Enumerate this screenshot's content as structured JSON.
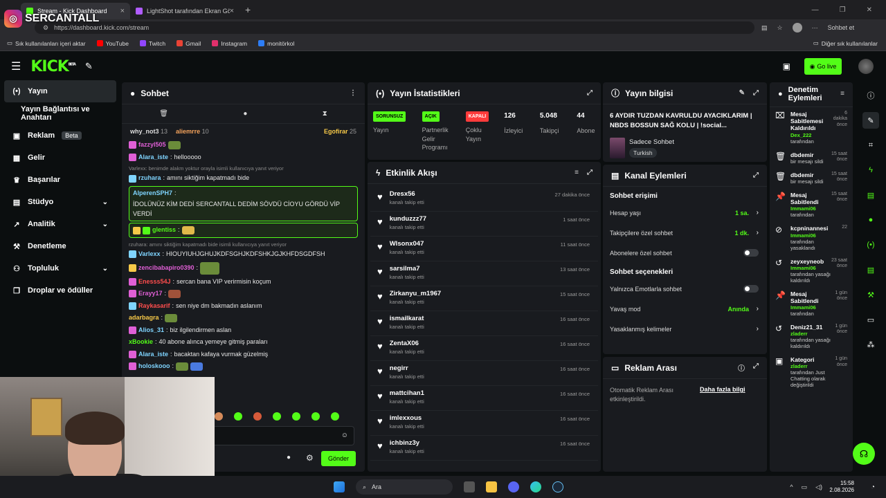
{
  "browser": {
    "tabs": [
      {
        "label": "Stream - Kick Dashboard",
        "active": true
      },
      {
        "label": "LightShot tarafından Ekran Görünt",
        "active": false
      }
    ],
    "url": "https://dashboard.kick.com/stream",
    "profile_label": "Sohbet et",
    "bookmarks": [
      "Sık kullanılanları içeri aktar",
      "YouTube",
      "Twitch",
      "Gmail",
      "Instagram",
      "monitörkol"
    ],
    "bookmarks_right": "Diğer sık kullanılanlar"
  },
  "overlay": {
    "streamer_name": "SERCANTALL"
  },
  "topbar": {
    "logo": "KICK",
    "logo_badge": "BETA",
    "go_live": "Go live"
  },
  "sidebar": {
    "items": [
      {
        "label": "Yayın",
        "icon": "broadcast-icon"
      },
      {
        "label": "Yayın Bağlantısı ve Anahtarı",
        "icon": ""
      },
      {
        "label": "Reklam",
        "icon": "ad-icon",
        "badge": "Beta"
      },
      {
        "label": "Gelir",
        "icon": "money-icon"
      },
      {
        "label": "Başarılar",
        "icon": "trophy-icon"
      },
      {
        "label": "Stüdyo",
        "icon": "studio-icon"
      },
      {
        "label": "Analitik",
        "icon": "analytics-icon"
      },
      {
        "label": "Denetleme",
        "icon": "hammer-icon"
      },
      {
        "label": "Topluluk",
        "icon": "community-icon"
      },
      {
        "label": "Droplar ve ödüller",
        "icon": "gift-icon"
      }
    ]
  },
  "chat": {
    "title": "Sohbet",
    "top_gifters": [
      {
        "name": "why_not3",
        "count": "13"
      },
      {
        "name": "aliemrre",
        "count": "10"
      },
      {
        "name": "Egofirar",
        "count": "25"
      }
    ],
    "messages": [
      {
        "user": "fazzyl505",
        "text": "",
        "color": "#e05fd6",
        "reply": ""
      },
      {
        "user": "Alara_iste",
        "text": "hellooooo",
        "color": "#7fd4ff",
        "reply": ""
      },
      {
        "user": "rzuhara",
        "text": "amını siktiğim kapatmadı bide",
        "color": "#7fd4ff",
        "reply": "Varlexx: benimde alakm yoktur orayla isimli kullanıcıya yanıt veriyor"
      },
      {
        "user": "AlperenSPH7",
        "text": "İDOLÜNÜZ KİM DEDİ SERCANTALL DEDİM SÖVDÜ CİOYU GÖRDÜ VİP VERDİ",
        "color": "#7fd4ff",
        "reply": ""
      },
      {
        "user": "glentiss",
        "text": "",
        "color": "#53fc18",
        "reply": ""
      },
      {
        "user": "Varlexx",
        "text": "HIOUYIUHJGHUJKDFSGHJKDFSHKJGJKHFDSGDFSH",
        "color": "#7fd4ff",
        "reply": "rzuhara: amını siktiğim kapatmadı bide isimli kullanıcıya yanıt veriyor"
      },
      {
        "user": "zencibabapiro0390",
        "text": "",
        "color": "#e05fd6",
        "reply": ""
      },
      {
        "user": "Enesss54J",
        "text": "sercan bana VIP verirmisin koçum",
        "color": "#ff4d4d",
        "reply": ""
      },
      {
        "user": "Erayy17",
        "text": "",
        "color": "#e05fd6",
        "reply": ""
      },
      {
        "user": "Raykasarif",
        "text": "sen niye dm bakmadın aslanım",
        "color": "#ff4d4d",
        "reply": ""
      },
      {
        "user": "adarbagra",
        "text": "",
        "color": "#f7c948",
        "reply": ""
      },
      {
        "user": "Alios_31",
        "text": "biz ilgilendirmen aslan",
        "color": "#7fd4ff",
        "reply": ""
      },
      {
        "user": "xBookie",
        "text": "40 abone alınca yemeye gitmiş paraları",
        "color": "#53fc18",
        "reply": ""
      },
      {
        "user": "Alara_iste",
        "text": "bacaktan kafaya vurmak güzelmiş",
        "color": "#7fd4ff",
        "reply": ""
      },
      {
        "user": "holoskooo",
        "text": "",
        "color": "#7fd4ff",
        "reply": ""
      }
    ],
    "send_label": "Gönder"
  },
  "stats": {
    "title": "Yayın İstatistikleri",
    "items": [
      {
        "tag": "SORUNSUZ",
        "label": "Yayın",
        "tag_color": "#53fc18"
      },
      {
        "tag": "AÇIK",
        "label": "Partnerlik Gelir Programı",
        "tag_color": "#53fc18"
      },
      {
        "tag": "KAPALI",
        "label": "Çoklu Yayın",
        "tag_color": "#ff3b3b"
      },
      {
        "num": "126",
        "label": "İzleyici"
      },
      {
        "num": "5.048",
        "label": "Takipçi"
      },
      {
        "num": "44",
        "label": "Abone Sayısı"
      }
    ]
  },
  "activity": {
    "title": "Etkinlik Akışı",
    "items": [
      {
        "name": "Dresx56",
        "sub": "kanalı takip etti",
        "time": "27 dakika önce"
      },
      {
        "name": "kunduzzz77",
        "sub": "kanalı takip etti",
        "time": "1 saat önce"
      },
      {
        "name": "Wlsonx047",
        "sub": "kanalı takip etti",
        "time": "11 saat önce"
      },
      {
        "name": "sarsilma7",
        "sub": "kanalı takip etti",
        "time": "13 saat önce"
      },
      {
        "name": "Zirkanyu_m1967",
        "sub": "kanalı takip etti",
        "time": "15 saat önce"
      },
      {
        "name": "ismailkarat",
        "sub": "kanalı takip etti",
        "time": "16 saat önce"
      },
      {
        "name": "ZentaX06",
        "sub": "kanalı takip etti",
        "time": "16 saat önce"
      },
      {
        "name": "negirr",
        "sub": "kanalı takip etti",
        "time": "16 saat önce"
      },
      {
        "name": "mattcihan1",
        "sub": "kanalı takip etti",
        "time": "16 saat önce"
      },
      {
        "name": "imlexxous",
        "sub": "kanalı takip etti",
        "time": "16 saat önce"
      },
      {
        "name": "ichbinz3y",
        "sub": "kanalı takip etti",
        "time": "16 saat önce"
      }
    ]
  },
  "stream_info": {
    "title": "Yayın bilgisi",
    "stream_title": "6 AYDIR TUZDAN KAVRULDU AYACIKLARIM | NBDS BOSSUN SAĞ KOLU | !social...",
    "category": "Sadece Sohbet",
    "language": "Turkish"
  },
  "channel_actions": {
    "title": "Kanal Eylemleri",
    "chat_access": "Sohbet erişimi",
    "rows1": [
      {
        "label": "Hesap yaşı",
        "value": "1 sa.",
        "type": "arrow"
      },
      {
        "label": "Takipçilere özel sohbet",
        "value": "1 dk.",
        "type": "arrow"
      },
      {
        "label": "Abonelere özel sohbet",
        "value": "",
        "type": "toggle"
      }
    ],
    "chat_options": "Sohbet seçenekleri",
    "rows2": [
      {
        "label": "Yalnızca Emotlarla sohbet",
        "value": "",
        "type": "toggle"
      },
      {
        "label": "Yavaş mod",
        "value": "Anında",
        "type": "arrow"
      },
      {
        "label": "Yasaklanmış kelimeler",
        "value": "",
        "type": "arrow"
      }
    ]
  },
  "ad_break": {
    "title": "Reklam Arası",
    "text": "Otomatik Reklam Arası etkinleştirildi.",
    "link": "Daha fazla bilgi"
  },
  "mod_actions": {
    "title": "Denetim Eylemleri",
    "items": [
      {
        "title": "Mesaj Sabitlemesi Kaldırıldı",
        "by": "Dex_222",
        "suffix": "tarafından",
        "time": "6 dakika önce",
        "icon": "unpin-icon"
      },
      {
        "title": "dbdemir",
        "by": "",
        "suffix": "bir mesajı sildi",
        "time": "15 saat önce",
        "icon": "trash-icon"
      },
      {
        "title": "dbdemir",
        "by": "",
        "suffix": "bir mesajı sildi",
        "time": "15 saat önce",
        "icon": "trash-icon"
      },
      {
        "title": "Mesaj Sabitlendi",
        "by": "Immami06",
        "suffix": "tarafından",
        "time": "15 saat önce",
        "icon": "pin-icon"
      },
      {
        "title": "kcpninannesi",
        "by": "Immami06",
        "suffix": "tarafından yasaklandı",
        "time": "22",
        "icon": "ban-icon"
      },
      {
        "title": "zeyxeyneob",
        "by": "Immami06",
        "suffix": "tarafından yasağı kaldırıldı",
        "time": "23 saat önce",
        "icon": "undo-icon"
      },
      {
        "title": "Mesaj Sabitlendi",
        "by": "Immami06",
        "suffix": "tarafından",
        "time": "1 gün önce",
        "icon": "pin-icon"
      },
      {
        "title": "Deniz21_31",
        "by": "zladerr",
        "suffix": "tarafından yasağı kaldırıldı",
        "time": "1 gün önce",
        "icon": "undo-icon"
      },
      {
        "title": "Kategori",
        "by": "zladerr",
        "suffix": "tarafından Just Chatting olarak değiştirildi",
        "time": "1 gün önce",
        "icon": "category-icon"
      }
    ]
  },
  "taskbar": {
    "search": "Ara",
    "time": "15:58",
    "date": "2.08.2026"
  }
}
